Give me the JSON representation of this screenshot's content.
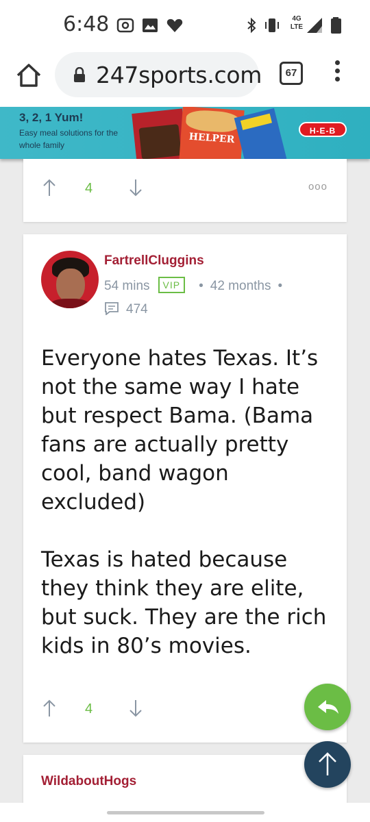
{
  "status_bar": {
    "time": "6:48",
    "network": "4G LTE",
    "icons": [
      "cast-icon",
      "image-icon",
      "heart-icon",
      "bluetooth-icon",
      "vibrate-icon",
      "signal-icon",
      "battery-icon"
    ]
  },
  "browser": {
    "url": "247sports.com",
    "tab_count": "67",
    "icons": [
      "home-icon",
      "lock-icon",
      "menu-icon"
    ]
  },
  "ad": {
    "headline": "3, 2, 1 Yum!",
    "subline": "Easy meal solutions for the whole family",
    "product_text": "HELPER",
    "brand": "H-E-B",
    "colors": {
      "background": "#3fb8c8",
      "brand": "#e11b22"
    }
  },
  "top_card": {
    "vote_count": "4",
    "more_label": "ooo"
  },
  "main_post": {
    "username": "FartrellCluggins",
    "time_ago": "54 mins",
    "badge": "VIP",
    "membership": "42 months",
    "post_count": "474",
    "paragraphs": [
      "Everyone hates Texas. It’s not the same way I hate but respect Bama. (Bama fans are actually pretty cool, band wagon excluded)",
      "Texas is hated because they think they are elite, but suck. They are the rich kids in 80’s movies."
    ],
    "vote_count": "4"
  },
  "next_post": {
    "username": "WildaboutHogs"
  },
  "colors": {
    "username": "#a31f34",
    "accent_green": "#6bbd45",
    "scroll_top_button": "#23445e",
    "meta_gray": "#8a96a3"
  }
}
